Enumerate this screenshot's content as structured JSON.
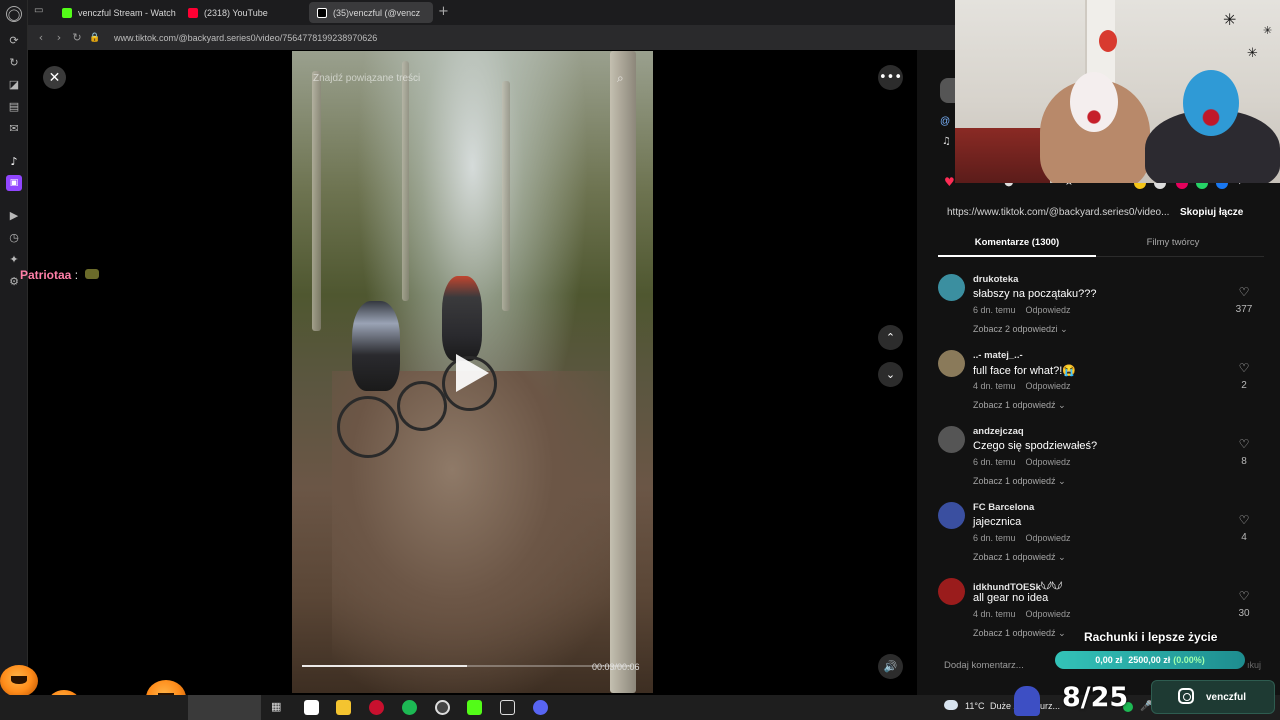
{
  "browser": {
    "tabs": [
      {
        "label": "venczful Stream - Watch L",
        "color": "#53fc18"
      },
      {
        "label": "(2318) YouTube",
        "color": "#ff0033"
      },
      {
        "label": "(35)venczful (@vencz",
        "color": "#ffffff"
      }
    ],
    "url": "www.tiktok.com/@backyard.series0/video/7564778199238970626"
  },
  "chat": {
    "user": "Patriotaa",
    "separator": " :"
  },
  "video": {
    "search_hint": "Znajdź powiązane treści",
    "time": "00:03/00:06",
    "progress": 0.5
  },
  "panel": {
    "link": "https://www.tiktok.com/@backyard.series0/video...",
    "copy_link": "Skopiuj łącze",
    "tab_comments": "Komentarze (1300)",
    "tab_creator": "Filmy twórcy",
    "comments": [
      {
        "author": "drukoteka",
        "text": "słabszy na początaku???",
        "time": "6 dn. temu",
        "reply": "Odpowiedz",
        "more": "Zobacz 2 odpowiedzi",
        "likes": "377",
        "avatar": "#3b8fa0"
      },
      {
        "author": "..- matej_..-",
        "text": "full face for what?!😭",
        "time": "4 dn. temu",
        "reply": "Odpowiedz",
        "more": "Zobacz 1 odpowiedź",
        "likes": "2",
        "avatar": "#8a7a5a"
      },
      {
        "author": "andzejczaq",
        "text": "Czego się spodziewałeś?",
        "time": "6 dn. temu",
        "reply": "Odpowiedz",
        "more": "Zobacz 1 odpowiedź",
        "likes": "8",
        "avatar": "#555555"
      },
      {
        "author": "FC Barcelona",
        "text": "jajecznica",
        "time": "6 dn. temu",
        "reply": "Odpowiedz",
        "more": "Zobacz 1 odpowiedź",
        "likes": "4",
        "avatar": "#3a4fa0"
      },
      {
        "author": "idkhundTOESk𓆩𓆪𓆩𓆪",
        "text": "all gear no idea",
        "time": "4 dn. temu",
        "reply": "Odpowiedz",
        "more": "Zobacz 1 odpowiedź",
        "likes": "30",
        "avatar": "#9a1c1c"
      }
    ],
    "add_comment": "Dodaj komentarz..."
  },
  "goal": {
    "title": "Rachunki i lepsze życie",
    "current": "0,00 zł",
    "target": "2500,00 zł",
    "percent": "(0.00%)",
    "extra": "ıkuj"
  },
  "counter": "8/25",
  "instagram": "venczful",
  "taskbar": {
    "temp": "11°C",
    "weather": "Duże zachmurz..."
  },
  "colors": {
    "accent": "#33c3b8",
    "twitch": "#9146ff",
    "kick": "#53fc18"
  }
}
